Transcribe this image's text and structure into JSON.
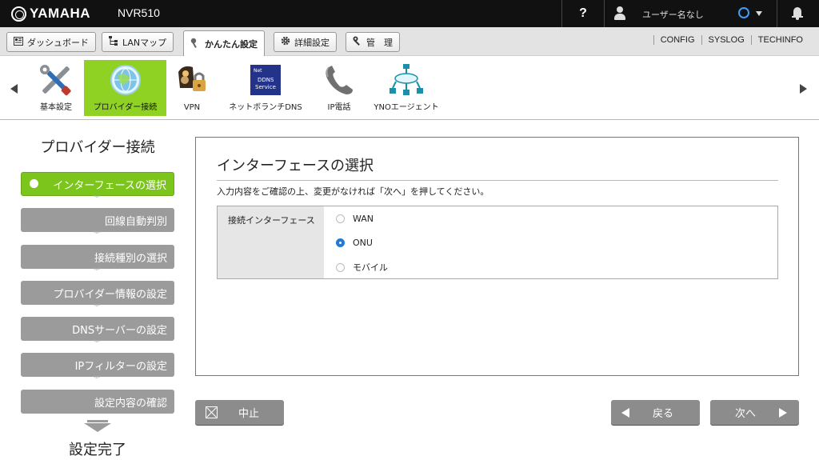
{
  "header": {
    "brand": "YAMAHA",
    "model": "NVR510",
    "help_label": "?",
    "user_name": "ユーザー名なし",
    "status_color": "#3aa0ff"
  },
  "nav": {
    "tabs": [
      {
        "label": "ダッシュボード",
        "icon": "dashboard-icon"
      },
      {
        "label": "LANマップ",
        "icon": "lan-map-icon"
      },
      {
        "label": "かんたん設定",
        "icon": "wizard-icon",
        "active": true
      },
      {
        "label": "詳細設定",
        "icon": "gear-icon"
      },
      {
        "label": "管　理",
        "icon": "wrench-icon"
      }
    ],
    "links": [
      "CONFIG",
      "SYSLOG",
      "TECHINFO"
    ]
  },
  "icon_strip": {
    "items": [
      {
        "label": "基本設定",
        "icon": "tools-icon"
      },
      {
        "label": "プロバイダー接続",
        "icon": "globe-icon",
        "selected": true
      },
      {
        "label": "VPN",
        "icon": "vpn-lock-icon"
      },
      {
        "label": "ネットボランチDNS",
        "icon": "ddns-icon"
      },
      {
        "label": "IP電話",
        "icon": "phone-icon"
      },
      {
        "label": "YNOエージェント",
        "icon": "network-icon"
      }
    ],
    "accent": "#8fd223"
  },
  "wizard": {
    "title": "プロバイダー接続",
    "steps": [
      {
        "label": "インターフェースの選択",
        "active": true
      },
      {
        "label": "回線自動判別"
      },
      {
        "label": "接続種別の選択"
      },
      {
        "label": "プロバイダー情報の設定"
      },
      {
        "label": "DNSサーバーの設定"
      },
      {
        "label": "IPフィルターの設定"
      },
      {
        "label": "設定内容の確認"
      }
    ],
    "final_label": "設定完了",
    "chevron": "︾"
  },
  "main": {
    "title": "インターフェースの選択",
    "note": "入力内容をご確認の上、変更がなければ「次へ」を押してください。",
    "field_label": "接続インターフェース",
    "options": [
      {
        "label": "WAN",
        "selected": false
      },
      {
        "label": "ONU",
        "selected": true
      },
      {
        "label": "モバイル",
        "selected": false
      }
    ]
  },
  "buttons": {
    "cancel": "中止",
    "back": "戻る",
    "next": "次へ"
  }
}
